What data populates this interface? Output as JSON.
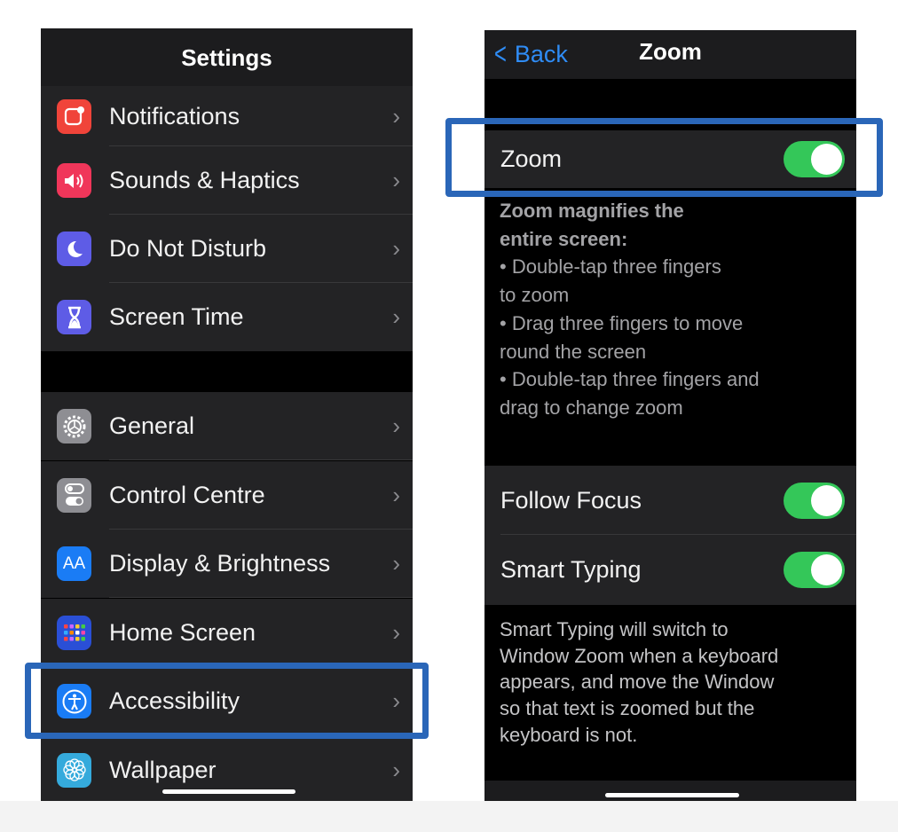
{
  "settings": {
    "title": "Settings",
    "group1": [
      {
        "label": "Notifications",
        "icon": "notifications-icon",
        "color": "#f0443a"
      },
      {
        "label": "Sounds & Haptics",
        "icon": "speaker-icon",
        "color": "#f0365a"
      },
      {
        "label": "Do Not Disturb",
        "icon": "moon-icon",
        "color": "#5e5ce6"
      },
      {
        "label": "Screen Time",
        "icon": "hourglass-icon",
        "color": "#5e5ce6"
      }
    ],
    "group2": [
      {
        "label": "General",
        "icon": "gear-icon",
        "color": "#8e8e93"
      },
      {
        "label": "Control Centre",
        "icon": "switches-icon",
        "color": "#8e8e93"
      },
      {
        "label": "Display & Brightness",
        "icon": "text-size-icon",
        "color": "#1a7cf5",
        "glyph": "AA"
      },
      {
        "label": "Home Screen",
        "icon": "app-grid-icon",
        "color": "#2a4fd6"
      },
      {
        "label": "Accessibility",
        "icon": "accessibility-icon",
        "color": "#1a7cf5"
      },
      {
        "label": "Wallpaper",
        "icon": "flower-icon",
        "color": "#35aadc"
      }
    ],
    "chevron": "›"
  },
  "zoom": {
    "back": "Back",
    "title": "Zoom",
    "zoom_toggle": {
      "label": "Zoom",
      "on": true
    },
    "zoom_footer_bold": [
      "Zoom magnifies the",
      "entire screen:"
    ],
    "zoom_footer": [
      "•  Double-tap three fingers",
      "to zoom",
      "•  Drag three fingers to move",
      "round the screen",
      "•  Double-tap three fingers and",
      "drag to change zoom"
    ],
    "follow_focus": {
      "label": "Follow Focus",
      "on": true
    },
    "smart_typing": {
      "label": "Smart Typing",
      "on": true
    },
    "smart_footer": [
      "Smart Typing will switch to",
      "Window Zoom when a keyboard",
      "appears, and move the Window",
      "so that text is zoomed but the",
      "keyboard is not."
    ]
  },
  "colors": {
    "highlight": "#2a66b8",
    "toggle_on": "#34c759",
    "link": "#2f8cf5"
  }
}
